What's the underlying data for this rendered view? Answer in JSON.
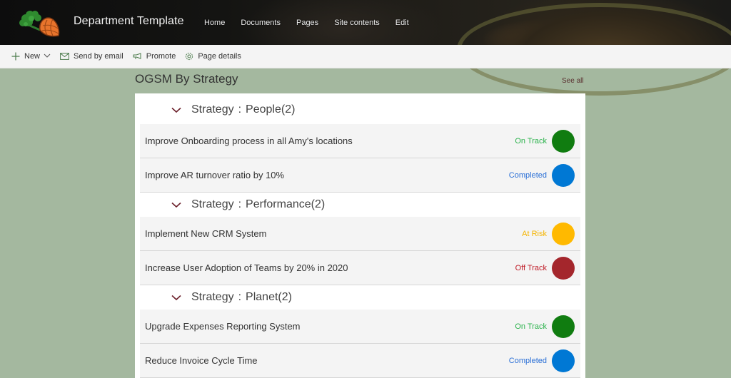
{
  "header": {
    "site_title": "Department Template",
    "logo_icon": "carrot-logo-icon",
    "nav": [
      "Home",
      "Documents",
      "Pages",
      "Site contents",
      "Edit"
    ]
  },
  "command_bar": {
    "new_label": "New",
    "send_label": "Send by email",
    "promote_label": "Promote",
    "details_label": "Page details"
  },
  "webpart": {
    "title": "OGSM By Strategy",
    "see_all": "See all",
    "groups": [
      {
        "prefix": "Strategy",
        "name": "People",
        "count": "(2)",
        "items": [
          {
            "title": "Improve Onboarding process in all Amy's locations",
            "status": "On Track",
            "status_color": "#2bb24c",
            "dot_color": "#107c10"
          },
          {
            "title": "Improve AR turnover ratio by 10%",
            "status": "Completed",
            "status_color": "#2a6fd6",
            "dot_color": "#0078d4"
          }
        ]
      },
      {
        "prefix": "Strategy",
        "name": "Performance",
        "count": "(2)",
        "items": [
          {
            "title": "Implement New CRM System",
            "status": "At Risk",
            "status_color": "#f5b400",
            "dot_color": "#ffb900"
          },
          {
            "title": "Increase User Adoption of Teams by 20% in 2020",
            "status": "Off Track",
            "status_color": "#c01c28",
            "dot_color": "#a4262c"
          }
        ]
      },
      {
        "prefix": "Strategy",
        "name": "Planet",
        "count": "(2)",
        "items": [
          {
            "title": "Upgrade Expenses Reporting System",
            "status": "On Track",
            "status_color": "#2bb24c",
            "dot_color": "#107c10"
          },
          {
            "title": "Reduce Invoice Cycle Time",
            "status": "Completed",
            "status_color": "#2a6fd6",
            "dot_color": "#0078d4"
          }
        ]
      }
    ]
  },
  "colors": {
    "page_background": "#a4b89f",
    "chevron": "#6b1f2a"
  }
}
